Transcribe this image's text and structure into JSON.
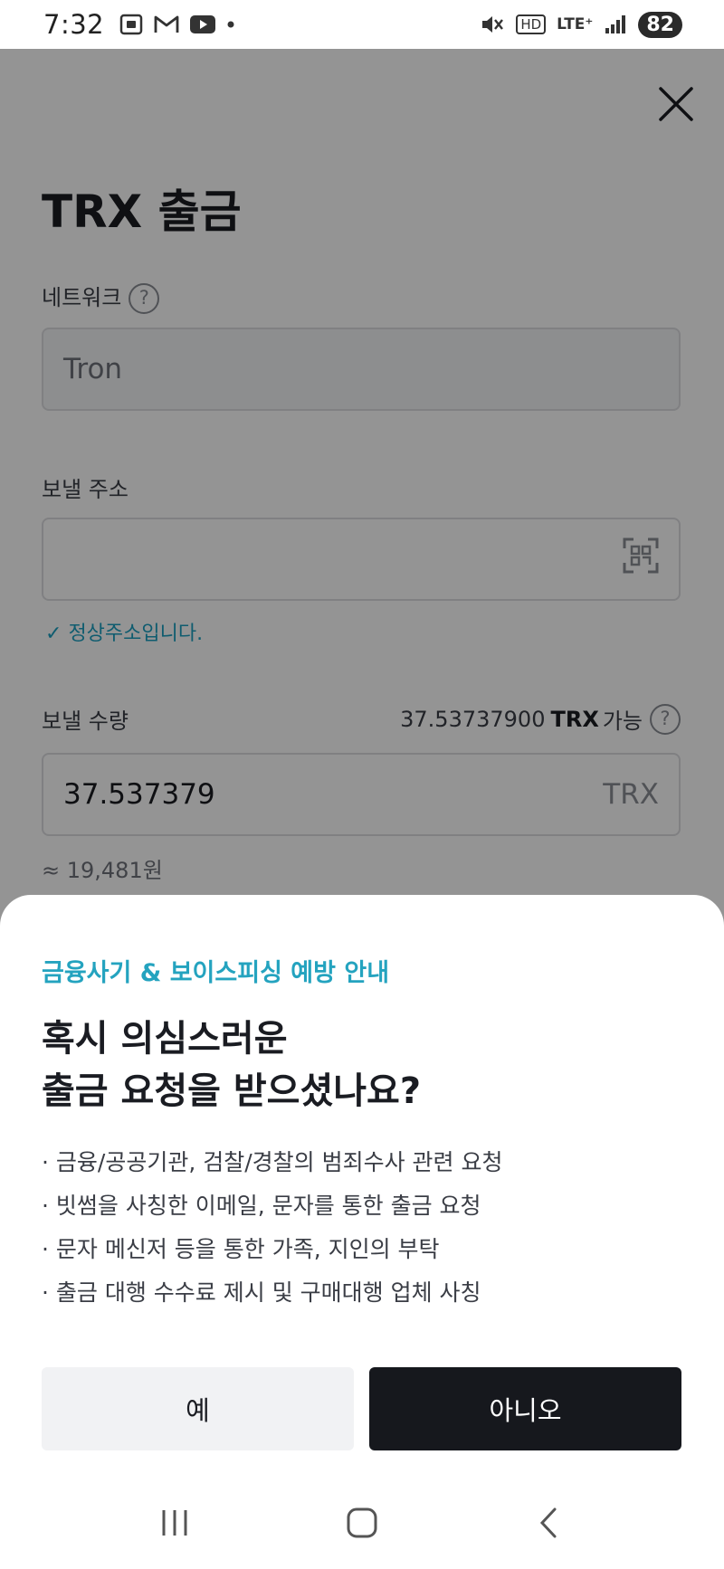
{
  "status_bar": {
    "time": "7:32",
    "left_icons": [
      "screenshot-icon",
      "gmail-icon",
      "youtube-icon",
      "dot-icon"
    ],
    "right_icons": [
      "mute-icon",
      "hd-icon",
      "lte-icon",
      "signal-icon"
    ],
    "network_type": "LTE⁺",
    "hd_label": "HD",
    "battery": "82"
  },
  "page": {
    "title": "TRX 출금",
    "network": {
      "label": "네트워크",
      "value": "Tron"
    },
    "address": {
      "label": "보낼 주소",
      "validation": "정상주소입니다."
    },
    "amount": {
      "label": "보낼 수량",
      "available_value": "37.53737900",
      "available_unit": "TRX",
      "available_suffix": "가능",
      "value": "37.537379",
      "unit": "TRX",
      "krw_equivalent": "≈ 19,481원"
    }
  },
  "sheet": {
    "notice_title": "금융사기 & 보이스피싱 예방 안내",
    "heading_line1": "혹시 의심스러운",
    "heading_line2": "출금 요청을 받으셨나요?",
    "bullets": [
      "금융/공공기관, 검찰/경찰의 범죄수사 관련 요청",
      "빗썸을 사칭한 이메일, 문자를 통한 출금 요청",
      "문자 메신저 등을 통한 가족, 지인의 부탁",
      "출금 대행 수수료 제시 및 구매대행 업체 사칭"
    ],
    "yes_label": "예",
    "no_label": "아니오"
  },
  "nav_bar": [
    "recent-apps-icon",
    "home-icon",
    "back-icon"
  ]
}
